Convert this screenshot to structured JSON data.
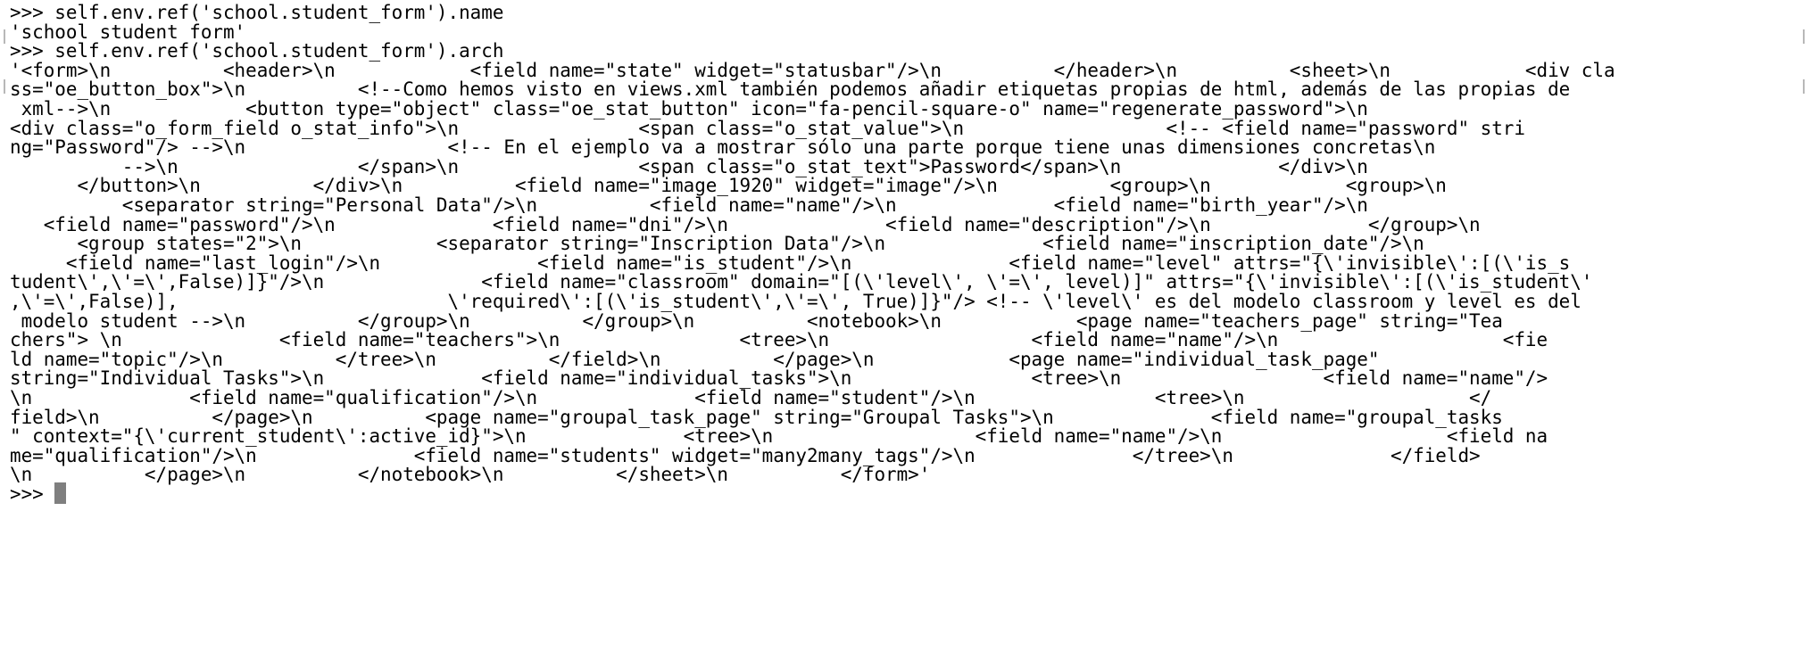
{
  "terminal": {
    "lines": [
      ">>> self.env.ref('school.student_form').name",
      "'school student form'",
      ">>> self.env.ref('school.student_form').arch",
      "'<form>\\n          <header>\\n            <field name=\"state\" widget=\"statusbar\"/>\\n          </header>\\n          <sheet>\\n            <div cla",
      "ss=\"oe_button_box\">\\n          <!--Como hemos visto en views.xml también podemos añadir etiquetas propias de html, además de las propias de",
      " xml-->\\n            <button type=\"object\" class=\"oe_stat_button\" icon=\"fa-pencil-square-o\" name=\"regenerate_password\">\\n",
      "<div class=\"o_form_field o_stat_info\">\\n                <span class=\"o_stat_value\">\\n                  <!-- <field name=\"password\" stri",
      "ng=\"Password\"/> -->\\n                  <!-- En el ejemplo va a mostrar sólo una parte porque tiene unas dimensiones concretas\\n",
      "          -->\\n                </span>\\n                <span class=\"o_stat_text\">Password</span>\\n              </div>\\n",
      "      </button>\\n          </div>\\n          <field name=\"image_1920\" widget=\"image\"/>\\n          <group>\\n            <group>\\n",
      "          <separator string=\"Personal Data\"/>\\n          <field name=\"name\"/>\\n              <field name=\"birth_year\"/>\\n",
      "   <field name=\"password\"/>\\n              <field name=\"dni\"/>\\n              <field name=\"description\"/>\\n              </group>\\n",
      "      <group states=\"2\">\\n            <separator string=\"Inscription Data\"/>\\n              <field name=\"inscription_date\"/>\\n",
      "     <field name=\"last_login\"/>\\n              <field name=\"is_student\"/>\\n              <field name=\"level\" attrs=\"{\\'invisible\\':[(\\'is_s",
      "tudent\\',\\'=\\',False)]}\"/>\\n              <field name=\"classroom\" domain=\"[(\\'level\\', \\'=\\', level)]\" attrs=\"{\\'invisible\\':[(\\'is_student\\'",
      ",\\'=\\',False)],                        \\'required\\':[(\\'is_student\\',\\'=\\', True)]}\"/> <!-- \\'level\\' es del modelo classroom y level es del",
      " modelo student -->\\n          </group>\\n          </group>\\n          <notebook>\\n            <page name=\"teachers_page\" string=\"Tea",
      "chers\"> \\n              <field name=\"teachers\">\\n                <tree>\\n                  <field name=\"name\"/>\\n                    <fie",
      "ld name=\"topic\"/>\\n          </tree>\\n          </field>\\n          </page>\\n            <page name=\"individual_task_page\"",
      "string=\"Individual Tasks\">\\n              <field name=\"individual_tasks\">\\n                <tree>\\n                  <field name=\"name\"/>",
      "\\n              <field name=\"qualification\"/>\\n              <field name=\"student\"/>\\n                <tree>\\n                    </",
      "field>\\n          </page>\\n          <page name=\"groupal_task_page\" string=\"Groupal Tasks\">\\n              <field name=\"groupal_tasks",
      "\" context=\"{\\'current_student\\':active_id}\">\\n              <tree>\\n                  <field name=\"name\"/>\\n                    <field na",
      "me=\"qualification\"/>\\n              <field name=\"students\" widget=\"many2many_tags\"/>\\n              </tree>\\n              </field>",
      "\\n          </page>\\n          </notebook>\\n          </sheet>\\n          </form>'"
    ],
    "prompt": ">>> "
  }
}
